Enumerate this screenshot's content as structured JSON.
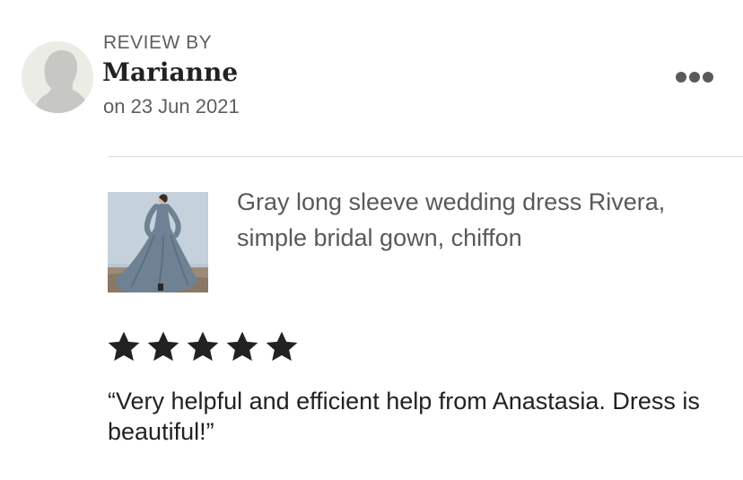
{
  "review": {
    "label": "REVIEW BY",
    "reviewer_name": "Marianne",
    "date": "on 23 Jun 2021",
    "more_icon": "more-horizontal-icon",
    "product": {
      "title": "Gray long sleeve wedding dress Rivera, simple bridal gown, chiffon",
      "image": "dress-thumbnail"
    },
    "rating": {
      "stars": 5,
      "max": 5,
      "icon": "star-icon",
      "color": "#222222"
    },
    "text": "“Very helpful and efficient help from Anastasia. Dress is beautiful!”"
  },
  "colors": {
    "muted_text": "#5e5e5e",
    "divider": "#d9d9d9",
    "avatar_bg": "#ecece6",
    "avatar_silhouette": "#c7c7c3",
    "dress": "#6e8294",
    "photo_bg": "#b9c7d2"
  }
}
